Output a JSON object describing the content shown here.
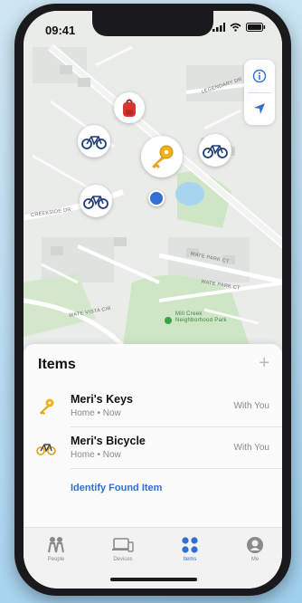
{
  "status_bar": {
    "time": "09:41"
  },
  "map": {
    "labels": {
      "street_1": "LEGENDARY DR",
      "street_2": "CREEKSIDE DR",
      "street_3": "WATE PARK CT",
      "street_4": "WATE PARK CT",
      "street_5": "WATE VISTA CIR",
      "park": "Mill Creek Neighborhood Park"
    }
  },
  "sheet": {
    "title": "Items",
    "add_label": "+",
    "items": [
      {
        "name": "Meri's Keys",
        "subtitle": "Home • Now",
        "status": "With You"
      },
      {
        "name": "Meri's Bicycle",
        "subtitle": "Home • Now",
        "status": "With You"
      }
    ],
    "identify_label": "Identify Found Item"
  },
  "tabs": [
    {
      "label": "People"
    },
    {
      "label": "Devices"
    },
    {
      "label": "Items"
    },
    {
      "label": "Me"
    }
  ],
  "colors": {
    "accent": "#2f6fd6",
    "map_base": "#eaeeea",
    "park_green": "#bfe0b0"
  }
}
